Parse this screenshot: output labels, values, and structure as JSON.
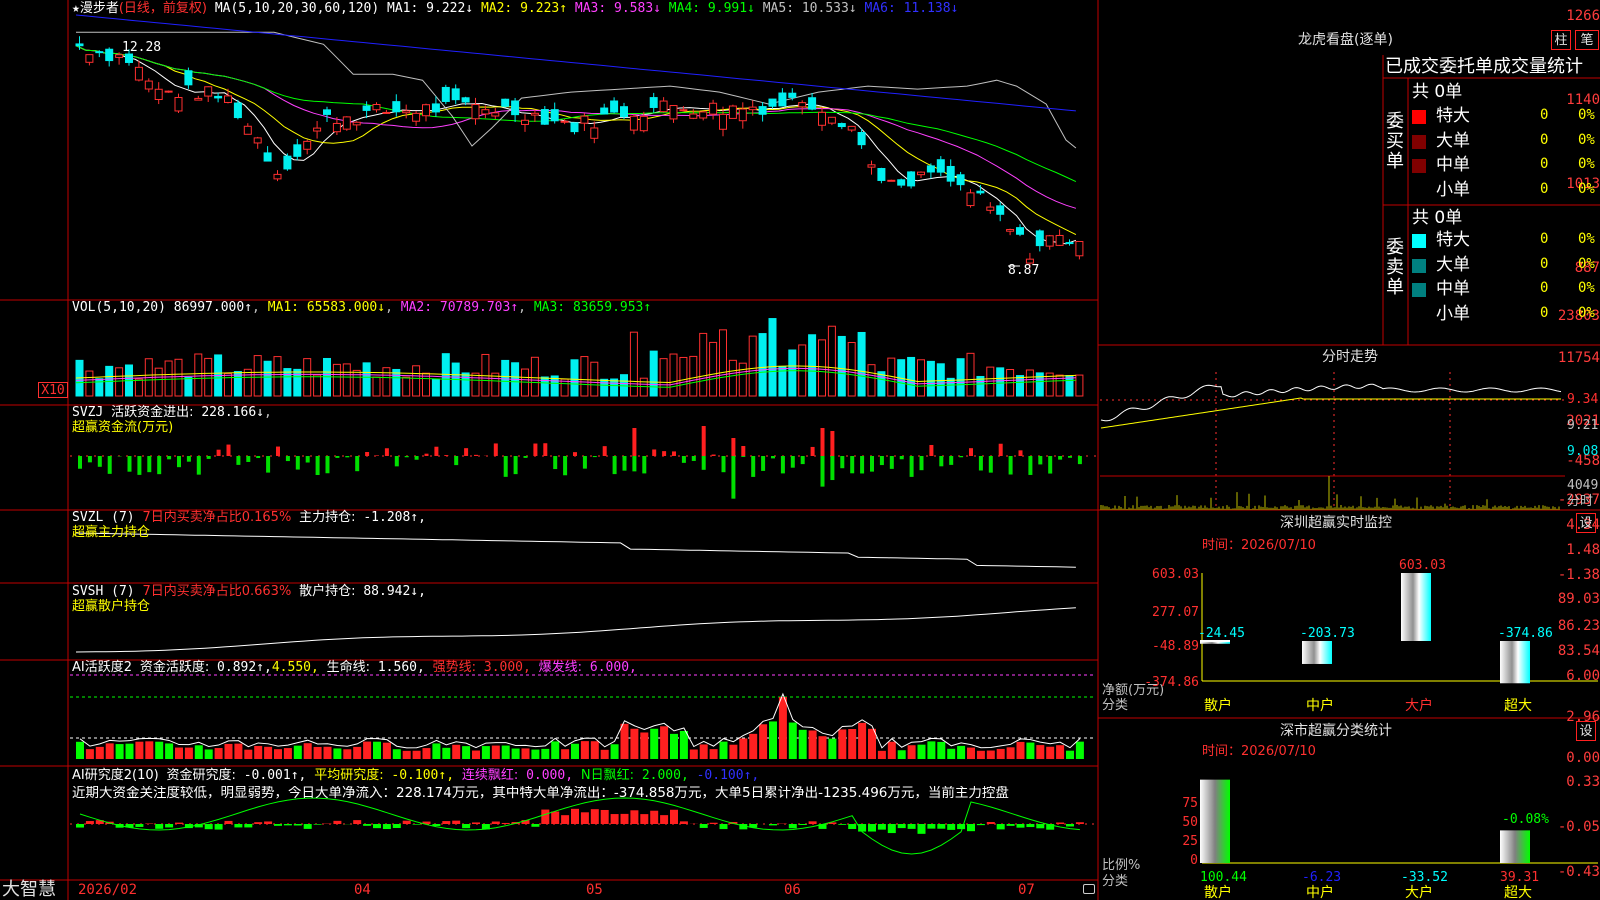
{
  "colors": {
    "up": "#ff3030",
    "down": "#00f0f0",
    "border": "#c00000",
    "green": "#00ff00",
    "yellow": "#ffff00",
    "magenta": "#ff40ff",
    "blue": "#2020ff"
  },
  "price_panel": {
    "name": "漫步者",
    "period": "(日线，前复权)",
    "ma_title": "MA(5,10,20,30,60,120)",
    "ma": [
      {
        "k": "MA1:",
        "v": "9.222↓",
        "c": "#ffffff"
      },
      {
        "k": "MA2:",
        "v": "9.223↑",
        "c": "#ffff00"
      },
      {
        "k": "MA3:",
        "v": "9.583↓",
        "c": "#ff40ff"
      },
      {
        "k": "MA4:",
        "v": "9.991↓",
        "c": "#00ff00"
      },
      {
        "k": "MA5:",
        "v": "10.533↓",
        "c": "#c0c0c0"
      },
      {
        "k": "MA6:",
        "v": "11.138↓",
        "c": "#3030ff"
      }
    ],
    "ticks": [
      "1266",
      "1140",
      "1013",
      "887"
    ],
    "high_label": "12.28",
    "low_label": "8.87"
  },
  "vol_panel": {
    "title": "VOL(5,10,20)",
    "vol": "86997.000↑",
    "ma1": "MA1: 65583.000↓",
    "ma2": "MA2: 70789.703↑",
    "ma3": "MA3: 83659.953↑",
    "ticks": [
      "23803",
      "11754"
    ],
    "unit": "X10"
  },
  "svzj_panel": {
    "title": "SVZJ",
    "label": "活跃资金进出:",
    "value": "228.166↓",
    "sub": "超赢资金流(万元)",
    "ticks": [
      "2021",
      "-458",
      "-2937"
    ]
  },
  "svzl_panel": {
    "title": "SVZL (7)",
    "label": "7日内买卖净占比0.165%",
    "label2": "主力持仓:",
    "value": "-1.208↑,",
    "sub": "超赢主力持仓",
    "ticks": [
      "4.34",
      "1.48",
      "-1.38"
    ]
  },
  "svsh_panel": {
    "title": "SVSH (7)",
    "label": "7日内买卖净占比0.663%",
    "label2": "散户持仓:",
    "value": "88.942↓,",
    "sub": "超赢散户持仓",
    "ticks": [
      "89.03",
      "86.23",
      "83.54"
    ]
  },
  "ai1_panel": {
    "title": "AI活跃度2",
    "l1": "资金活跃度:",
    "v1": "0.892↑,",
    "v2": "4.550,",
    "l3": "生命线:",
    "v3": "1.560,",
    "l4": "强势线:",
    "v4": "3.000,",
    "l5": "爆发线:",
    "v5": "6.000,",
    "ticks": [
      "6.00",
      "2.96",
      "0.00"
    ]
  },
  "ai2_panel": {
    "title": "AI研究度2(10)",
    "l1": "资金研究度:",
    "v1": "-0.001↑,",
    "l2": "平均研究度:",
    "v2": "-0.100↑,",
    "l3": "连续飘红:",
    "v3": "0.000,",
    "l4": "N日飘红:",
    "v4": "2.000,",
    "v5": "-0.100↑,",
    "note": "近期大资金关注度较低，明显弱势，今日大单净流入：228.174万元，其中特大单净流出：-374.858万元，大单5日累计净出-1235.496万元，当前主力控盘",
    "ticks": [
      "0.33",
      "-0.05",
      "-0.43"
    ]
  },
  "footer": {
    "brand": "大智慧",
    "dates": [
      "2026/02",
      "04",
      "05",
      "06",
      "07"
    ]
  },
  "lhb": {
    "title": "龙虎看盘(逐单)",
    "btn1": "柱",
    "btn2": "笔",
    "subtitle": "已成交委托单成交量统计",
    "buy": {
      "side": "委买单",
      "total": "共 0单",
      "rows": [
        {
          "n": "特大",
          "v": "0",
          "p": "0%",
          "c": "#ff0000"
        },
        {
          "n": "大单",
          "v": "0",
          "p": "0%",
          "c": "#800000"
        },
        {
          "n": "中单",
          "v": "0",
          "p": "0%",
          "c": "#800000"
        },
        {
          "n": "小单",
          "v": "0",
          "p": "0%",
          "c": ""
        }
      ]
    },
    "sell": {
      "side": "委卖单",
      "total": "共 0单",
      "rows": [
        {
          "n": "特大",
          "v": "0",
          "p": "0%",
          "c": "#00ffff"
        },
        {
          "n": "大单",
          "v": "0",
          "p": "0%",
          "c": "#008080"
        },
        {
          "n": "中单",
          "v": "0",
          "p": "0%",
          "c": "#008080"
        },
        {
          "n": "小单",
          "v": "0",
          "p": "0%",
          "c": ""
        }
      ]
    }
  },
  "intraday": {
    "title": "分时走势",
    "ticks": [
      "9.34",
      "9.21",
      "9.08"
    ],
    "vol_tick": "4049",
    "vol_label": "分时"
  },
  "monitor": {
    "title": "深圳超赢实时监控",
    "btn": "设",
    "date": "时间：2026/07/10",
    "ticks": [
      "603.03",
      "277.07",
      "-48.89",
      "-374.86"
    ],
    "ylabel": "净额(万元)",
    "xlabel": "分类",
    "bars": [
      {
        "cat": "散户",
        "val": "-24.45"
      },
      {
        "cat": "中户",
        "val": "-203.73"
      },
      {
        "cat": "大户",
        "val": "603.03"
      },
      {
        "cat": "超大",
        "val": "-374.86"
      }
    ]
  },
  "classify": {
    "title": "深市超赢分类统计",
    "btn": "设",
    "date": "时间：2026/07/10",
    "ticks": [
      "75",
      "50",
      "25",
      "0"
    ],
    "ylabel": "比例%",
    "xlabel": "分类",
    "bar_label": "-0.08%",
    "bars": [
      {
        "cat": "散户",
        "val": "100.44"
      },
      {
        "cat": "中户",
        "val": "-6.23"
      },
      {
        "cat": "大户",
        "val": "-33.52"
      },
      {
        "cat": "超大",
        "val": "39.31"
      }
    ]
  }
}
